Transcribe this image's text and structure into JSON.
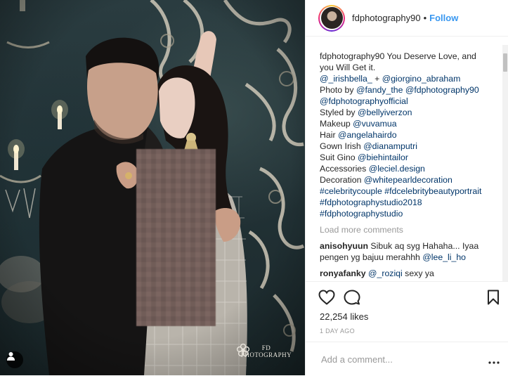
{
  "post": {
    "username": "fdphotography90",
    "separator": "•",
    "follow_label": "Follow",
    "watermark": "FD PHOTOGRAPHY",
    "caption_lines": [
      {
        "user": "fdphotography90",
        "text": " You Deserve Love, and"
      },
      {
        "text": "you Will Get it."
      },
      {
        "tag1": "@_irishbella_",
        "plus": " + ",
        "tag2": "@giorgino_abraham"
      },
      {
        "prefix": "Photo by ",
        "tag1": "@fandy_the",
        "mid": " ",
        "tag2": "@fdphotography90"
      },
      {
        "tag": "@fdphotographyofficial"
      },
      {
        "prefix": "Styled by ",
        "tag": "@bellyiverzon"
      },
      {
        "prefix": "Makeup ",
        "tag": "@vuvamua"
      },
      {
        "prefix": "Hair ",
        "tag": "@angelahairdo"
      },
      {
        "prefix": "Gown Irish ",
        "tag": "@dianamputri"
      },
      {
        "prefix": "Suit Gino ",
        "tag": "@biehintailor"
      },
      {
        "prefix": "Accessories ",
        "tag": "@leciel.design"
      },
      {
        "prefix": "Decoration ",
        "tag": "@whitepearldecoration"
      },
      {
        "tag1": "#celebritycouple",
        "mid": " ",
        "tag2": "#fdcelebritybeautyportrait"
      },
      {
        "tag": "#fdphotographystudio2018"
      },
      {
        "tag": "#fdphotographystudio"
      }
    ],
    "load_more": "Load more comments",
    "comments": [
      {
        "user": "anisohyuun",
        "text1": " Sibuk aq syg Hahaha... Iyaa",
        "text2": "pengen yg bajuu merahhh ",
        "mention": "@lee_li_ho"
      },
      {
        "user": "ronyafanky",
        "pre": " ",
        "mention": "@_roziqi",
        "text": " sexy ya"
      }
    ],
    "likes": "22,254 likes",
    "timestamp": "1 DAY AGO",
    "comment_placeholder": "Add a comment...",
    "icons": {
      "like": "heart-icon",
      "comment": "comment-icon",
      "save": "bookmark-icon",
      "more": "more-options-icon",
      "profile_toggle": "user-icon"
    },
    "colors": {
      "link": "#003569",
      "follow": "#3897f0",
      "muted": "#999999",
      "text": "#262626"
    }
  }
}
